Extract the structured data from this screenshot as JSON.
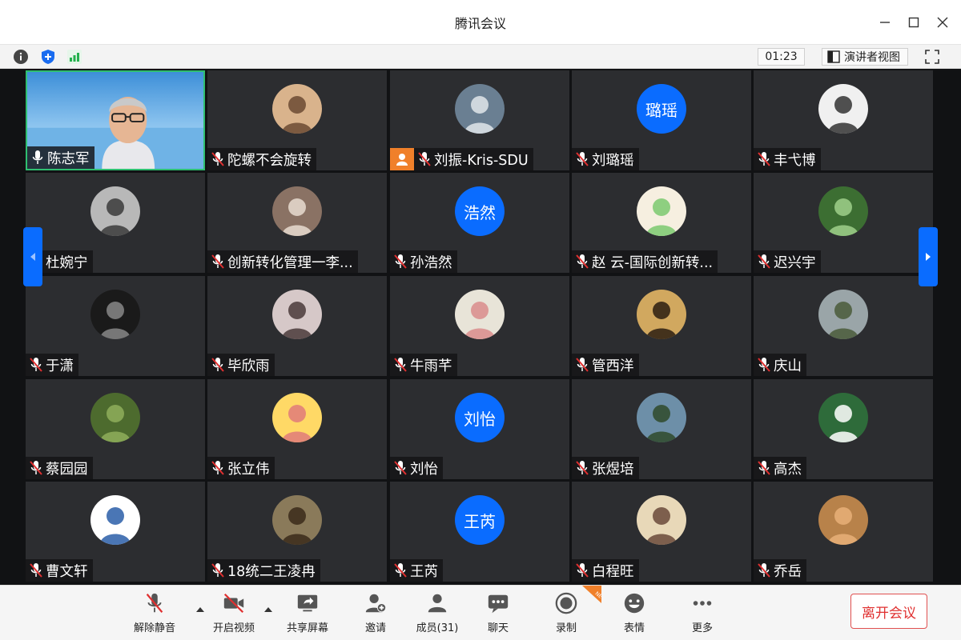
{
  "window": {
    "title": "腾讯会议"
  },
  "infobar": {
    "timer": "01:23",
    "speaker_view_label": "演讲者视图"
  },
  "participants": [
    {
      "name": "陈志军",
      "muted": false,
      "video": true
    },
    {
      "name": "陀螺不会旋转",
      "muted": true
    },
    {
      "name": "刘振-Kris-SDU",
      "muted": true,
      "host": true
    },
    {
      "name": "刘璐瑶",
      "muted": true,
      "avatar_text": "璐瑶"
    },
    {
      "name": "丰弋博",
      "muted": true
    },
    {
      "name": "杜婉宁",
      "muted": true
    },
    {
      "name": "创新转化管理一李...",
      "muted": true
    },
    {
      "name": "孙浩然",
      "muted": true,
      "avatar_text": "浩然"
    },
    {
      "name": "赵 云-国际创新转...",
      "muted": true
    },
    {
      "name": "迟兴宇",
      "muted": true
    },
    {
      "name": "于潇",
      "muted": true
    },
    {
      "name": "毕欣雨",
      "muted": true
    },
    {
      "name": "牛雨芊",
      "muted": true
    },
    {
      "name": "管西洋",
      "muted": true
    },
    {
      "name": "庆山",
      "muted": true
    },
    {
      "name": "蔡园园",
      "muted": true
    },
    {
      "name": "张立伟",
      "muted": true
    },
    {
      "name": "刘怡",
      "muted": true,
      "avatar_text": "刘怡"
    },
    {
      "name": "张煜培",
      "muted": true
    },
    {
      "name": "高杰",
      "muted": true
    },
    {
      "name": "曹文轩",
      "muted": true
    },
    {
      "name": "18统二王凌冉",
      "muted": true
    },
    {
      "name": "王芮",
      "muted": true,
      "avatar_text": "王芮"
    },
    {
      "name": "白程旺",
      "muted": true
    },
    {
      "name": "乔岳",
      "muted": true
    }
  ],
  "toolbar": {
    "unmute": "解除静音",
    "start_video": "开启视频",
    "share_screen": "共享屏幕",
    "invite": "邀请",
    "members": "成员(31)",
    "chat": "聊天",
    "record": "录制",
    "reactions": "表情",
    "more": "更多",
    "leave": "离开会议",
    "new_badge": "NEW"
  },
  "colors": {
    "accent": "#0a6cff",
    "tile_bg": "#2c2d30",
    "grid_bg": "#111214",
    "leave_red": "#e03030",
    "host_badge": "#f0802a"
  }
}
